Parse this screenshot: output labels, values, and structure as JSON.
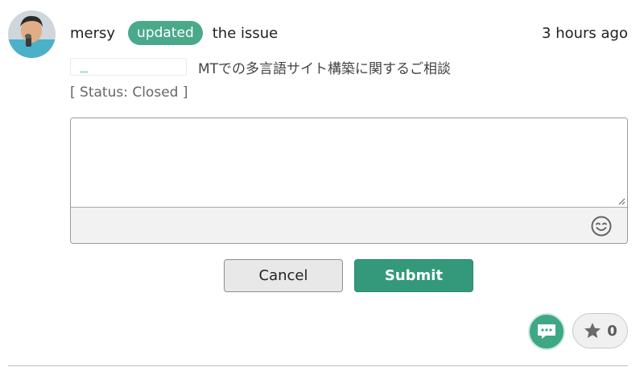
{
  "activity": {
    "username": "mersy",
    "action": "updated",
    "object_text": "the issue",
    "time": "3 hours ago",
    "issue_title": "MTでの多言語サイト構築に関するご相談",
    "status": "[ Status: Closed ]"
  },
  "editor": {
    "placeholder": "",
    "value": ""
  },
  "buttons": {
    "cancel": "Cancel",
    "submit": "Submit"
  },
  "reactions": {
    "star_count": "0"
  },
  "colors": {
    "accent": "#4aa98a",
    "submit": "#33997a",
    "comment_button": "#3ea784"
  },
  "icons": {
    "emoji": "smiley-icon",
    "comment": "speech-bubble-icon",
    "star": "star-icon",
    "resize": "resize-grip-icon"
  }
}
